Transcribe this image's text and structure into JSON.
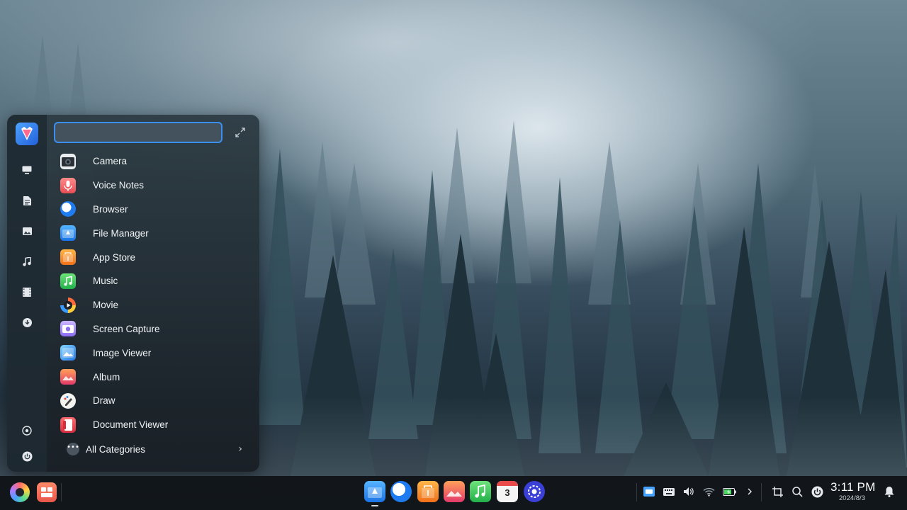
{
  "launcher": {
    "search": {
      "value": "",
      "placeholder": ""
    },
    "rail": [
      {
        "name": "desktop-icon"
      },
      {
        "name": "document-icon"
      },
      {
        "name": "picture-icon"
      },
      {
        "name": "music-note-icon"
      },
      {
        "name": "film-icon"
      },
      {
        "name": "download-icon"
      },
      {
        "name": "settings-icon"
      },
      {
        "name": "power-icon"
      }
    ],
    "apps": [
      {
        "label": "Camera",
        "icon": "camera-icon"
      },
      {
        "label": "Voice Notes",
        "icon": "voice-notes-icon"
      },
      {
        "label": "Browser",
        "icon": "browser-icon"
      },
      {
        "label": "File Manager",
        "icon": "file-manager-icon"
      },
      {
        "label": "App Store",
        "icon": "app-store-icon"
      },
      {
        "label": "Music",
        "icon": "music-icon"
      },
      {
        "label": "Movie",
        "icon": "movie-icon"
      },
      {
        "label": "Screen Capture",
        "icon": "screen-capture-icon"
      },
      {
        "label": "Image Viewer",
        "icon": "image-viewer-icon"
      },
      {
        "label": "Album",
        "icon": "album-icon"
      },
      {
        "label": "Draw",
        "icon": "draw-icon"
      },
      {
        "label": "Document Viewer",
        "icon": "document-viewer-icon"
      }
    ],
    "all_categories": "All Categories"
  },
  "dock": {
    "apps": [
      {
        "icon": "file-manager-icon"
      },
      {
        "icon": "browser-icon"
      },
      {
        "icon": "app-store-icon"
      },
      {
        "icon": "album-icon"
      },
      {
        "icon": "music-icon"
      },
      {
        "icon": "calendar-icon",
        "badge": "3"
      },
      {
        "icon": "control-center-icon"
      }
    ],
    "clock": {
      "time": "3:11 PM",
      "date": "2024/8/3"
    }
  },
  "colors": {
    "accent": "#3a8ff0",
    "dock_bg": "#121619"
  }
}
